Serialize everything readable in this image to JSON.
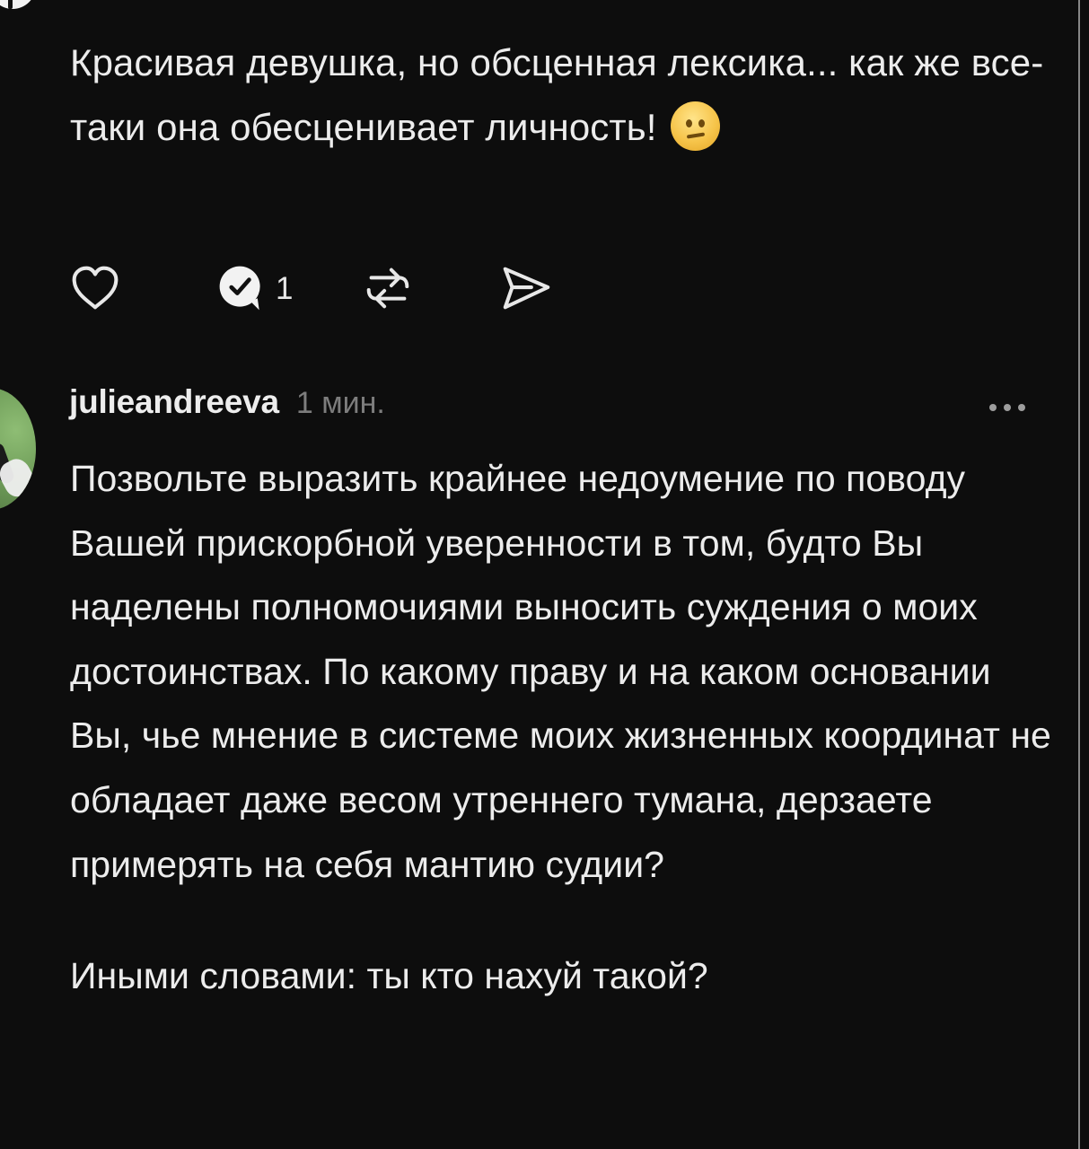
{
  "post": {
    "text": "Красивая девушка, но обсценная лексика... как же все-таки она обесценивает личность!",
    "emoji": "confused-face-emoji"
  },
  "actions": {
    "comment_count": "1"
  },
  "comment": {
    "username": "julieandreeva",
    "time": "1 мин.",
    "paragraph1": "Позвольте выразить крайнее недоумение по поводу Вашей прискорбной уверенности в том, будто Вы наделены полномочиями выносить суждения о моих достоинствах. По какому праву и на каком основании Вы, чье мнение в системе моих жизненных координат не обладает даже весом утреннего тумана, дерзаете примерять на себя мантию судии?",
    "paragraph2": "Иными словами: ты кто нахуй такой?"
  },
  "colors": {
    "background": "#0d0d0d",
    "text": "#ececec",
    "muted": "#7d7d7d"
  }
}
